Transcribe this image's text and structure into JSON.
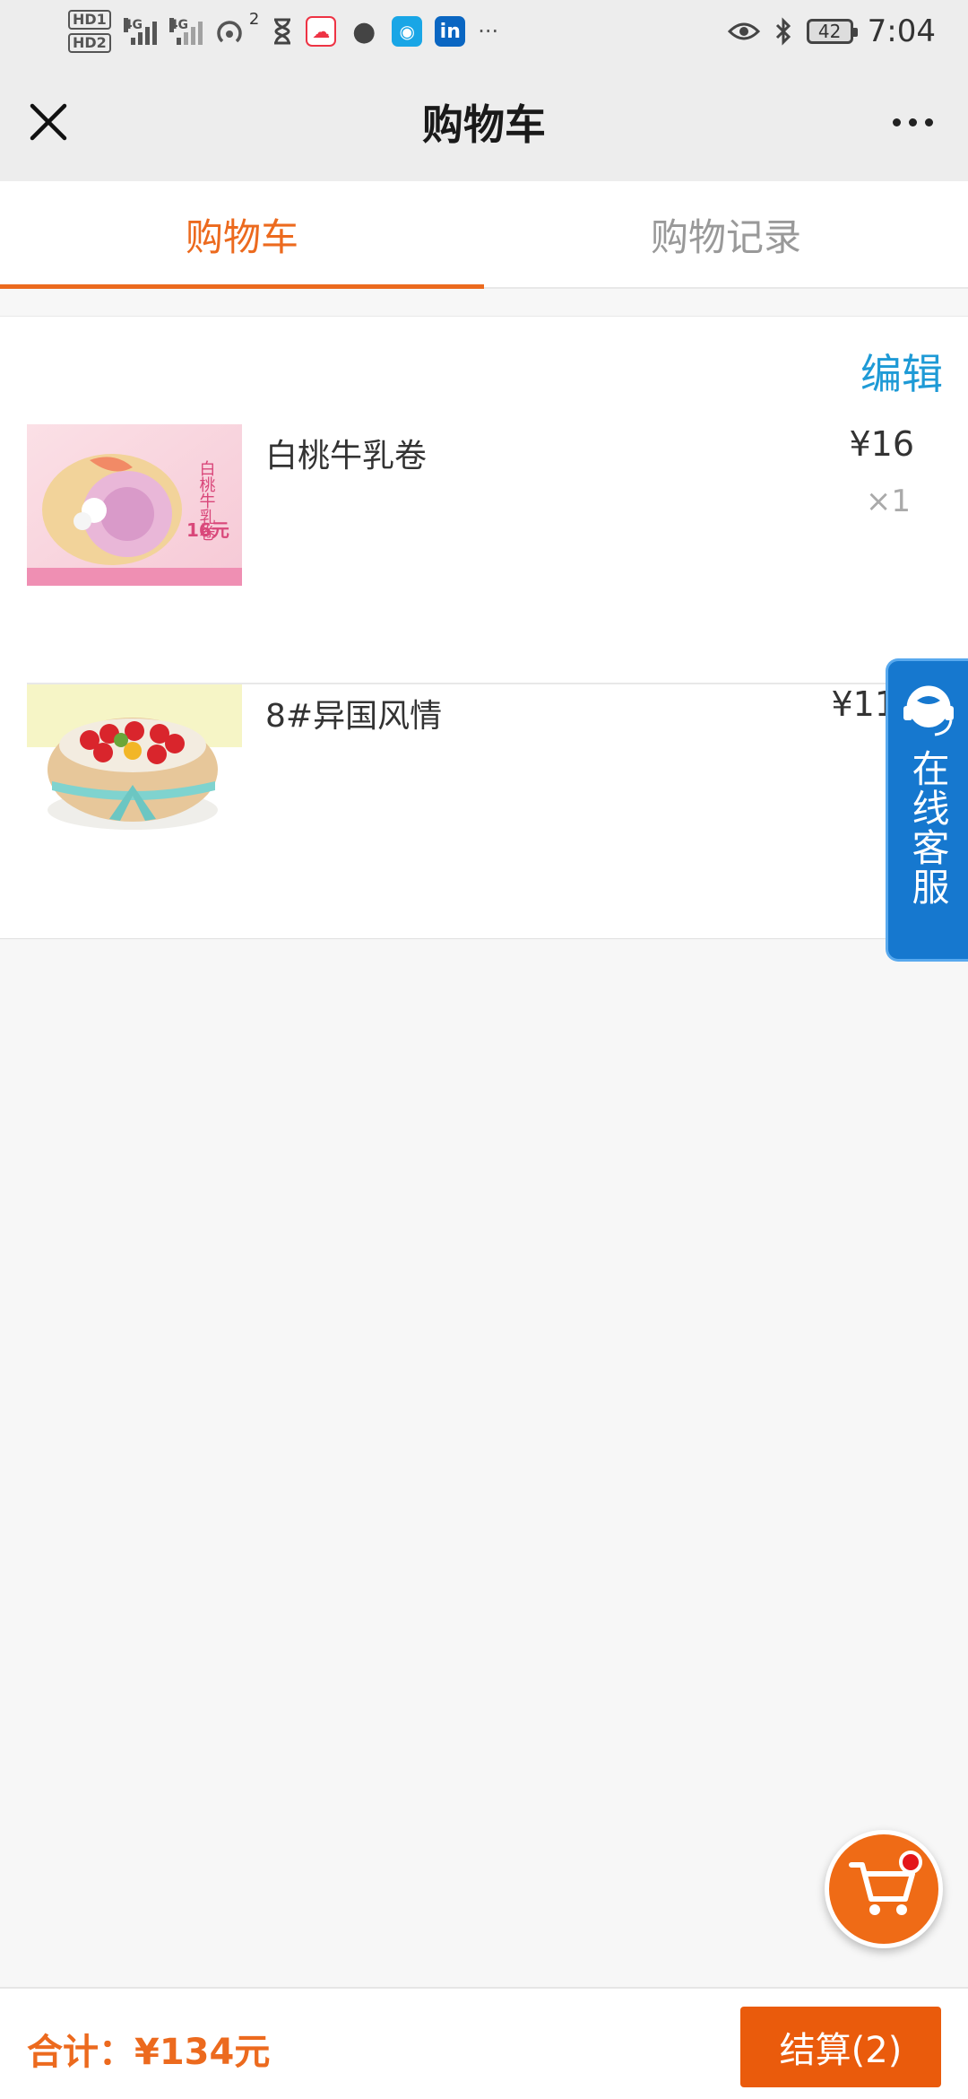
{
  "status_bar": {
    "hd1": "HD1",
    "hd2": "HD2",
    "net1": "4G",
    "net2": "4G",
    "hotspot_count": "2",
    "battery": "42",
    "time": "7:04",
    "more": "···"
  },
  "title_bar": {
    "title": "购物车"
  },
  "tabs": [
    {
      "label": "购物车",
      "active": true
    },
    {
      "label": "购物记录",
      "active": false
    }
  ],
  "cart": {
    "edit_label": "编辑",
    "items": [
      {
        "name": "白桃牛乳卷",
        "price": "¥16",
        "qty": "×1",
        "thumb_text": "白桃牛乳卷",
        "thumb_price": "16元"
      },
      {
        "name": "8#异国风情",
        "price": "¥11",
        "qty": "×"
      }
    ]
  },
  "customer_service": {
    "label": "在线客服"
  },
  "footer": {
    "total": "合计：¥134元",
    "checkout_label": "结算(2)"
  },
  "colors": {
    "accent": "#ec6a1e",
    "link": "#1e9ad6",
    "service_blue": "#1678cf"
  }
}
